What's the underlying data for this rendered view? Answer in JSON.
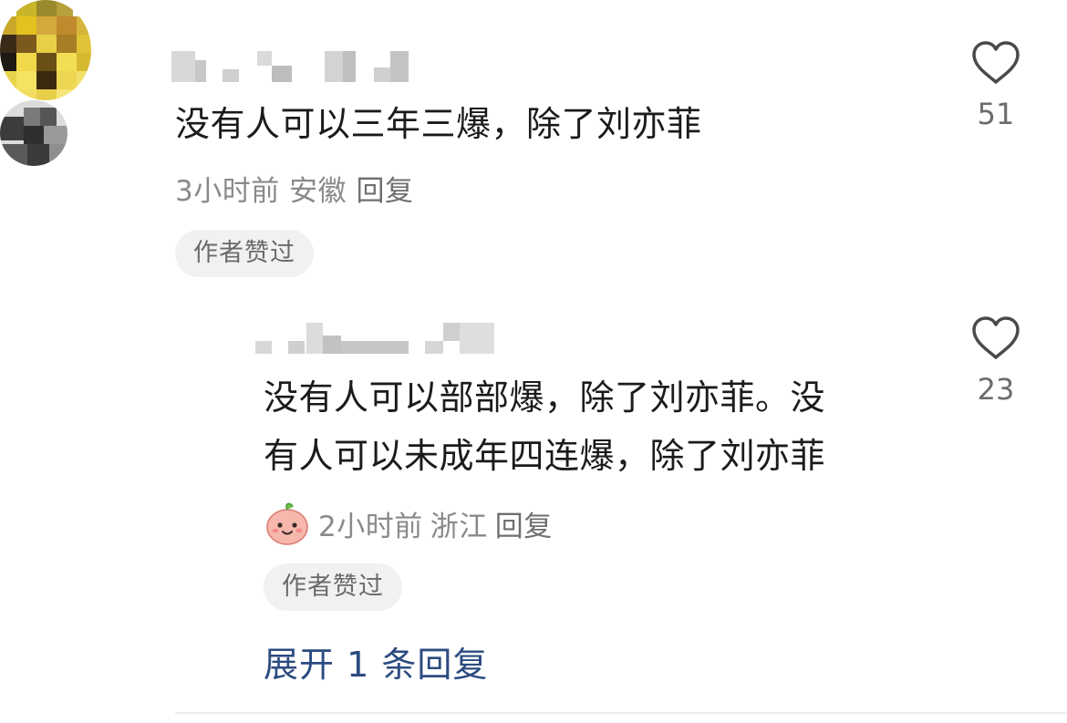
{
  "comment": {
    "text": "没有人可以三年三爆，除了刘亦菲",
    "time": "3小时前",
    "location": "安徽",
    "reply_label": "回复",
    "badge": "作者赞过",
    "likes": "51"
  },
  "reply": {
    "line1": "没有人可以部部爆，除了刘亦菲。没",
    "line2": "有人可以未成年四连爆，除了刘亦菲",
    "time": "2小时前",
    "location": "浙江",
    "reply_label": "回复",
    "badge": "作者赞过",
    "likes": "23"
  },
  "expand_label": "展开 1 条回复",
  "colors": {
    "expand_link": "#2c4b80",
    "meta_text": "#8a8a8a",
    "badge_bg": "#f1f1f1"
  }
}
